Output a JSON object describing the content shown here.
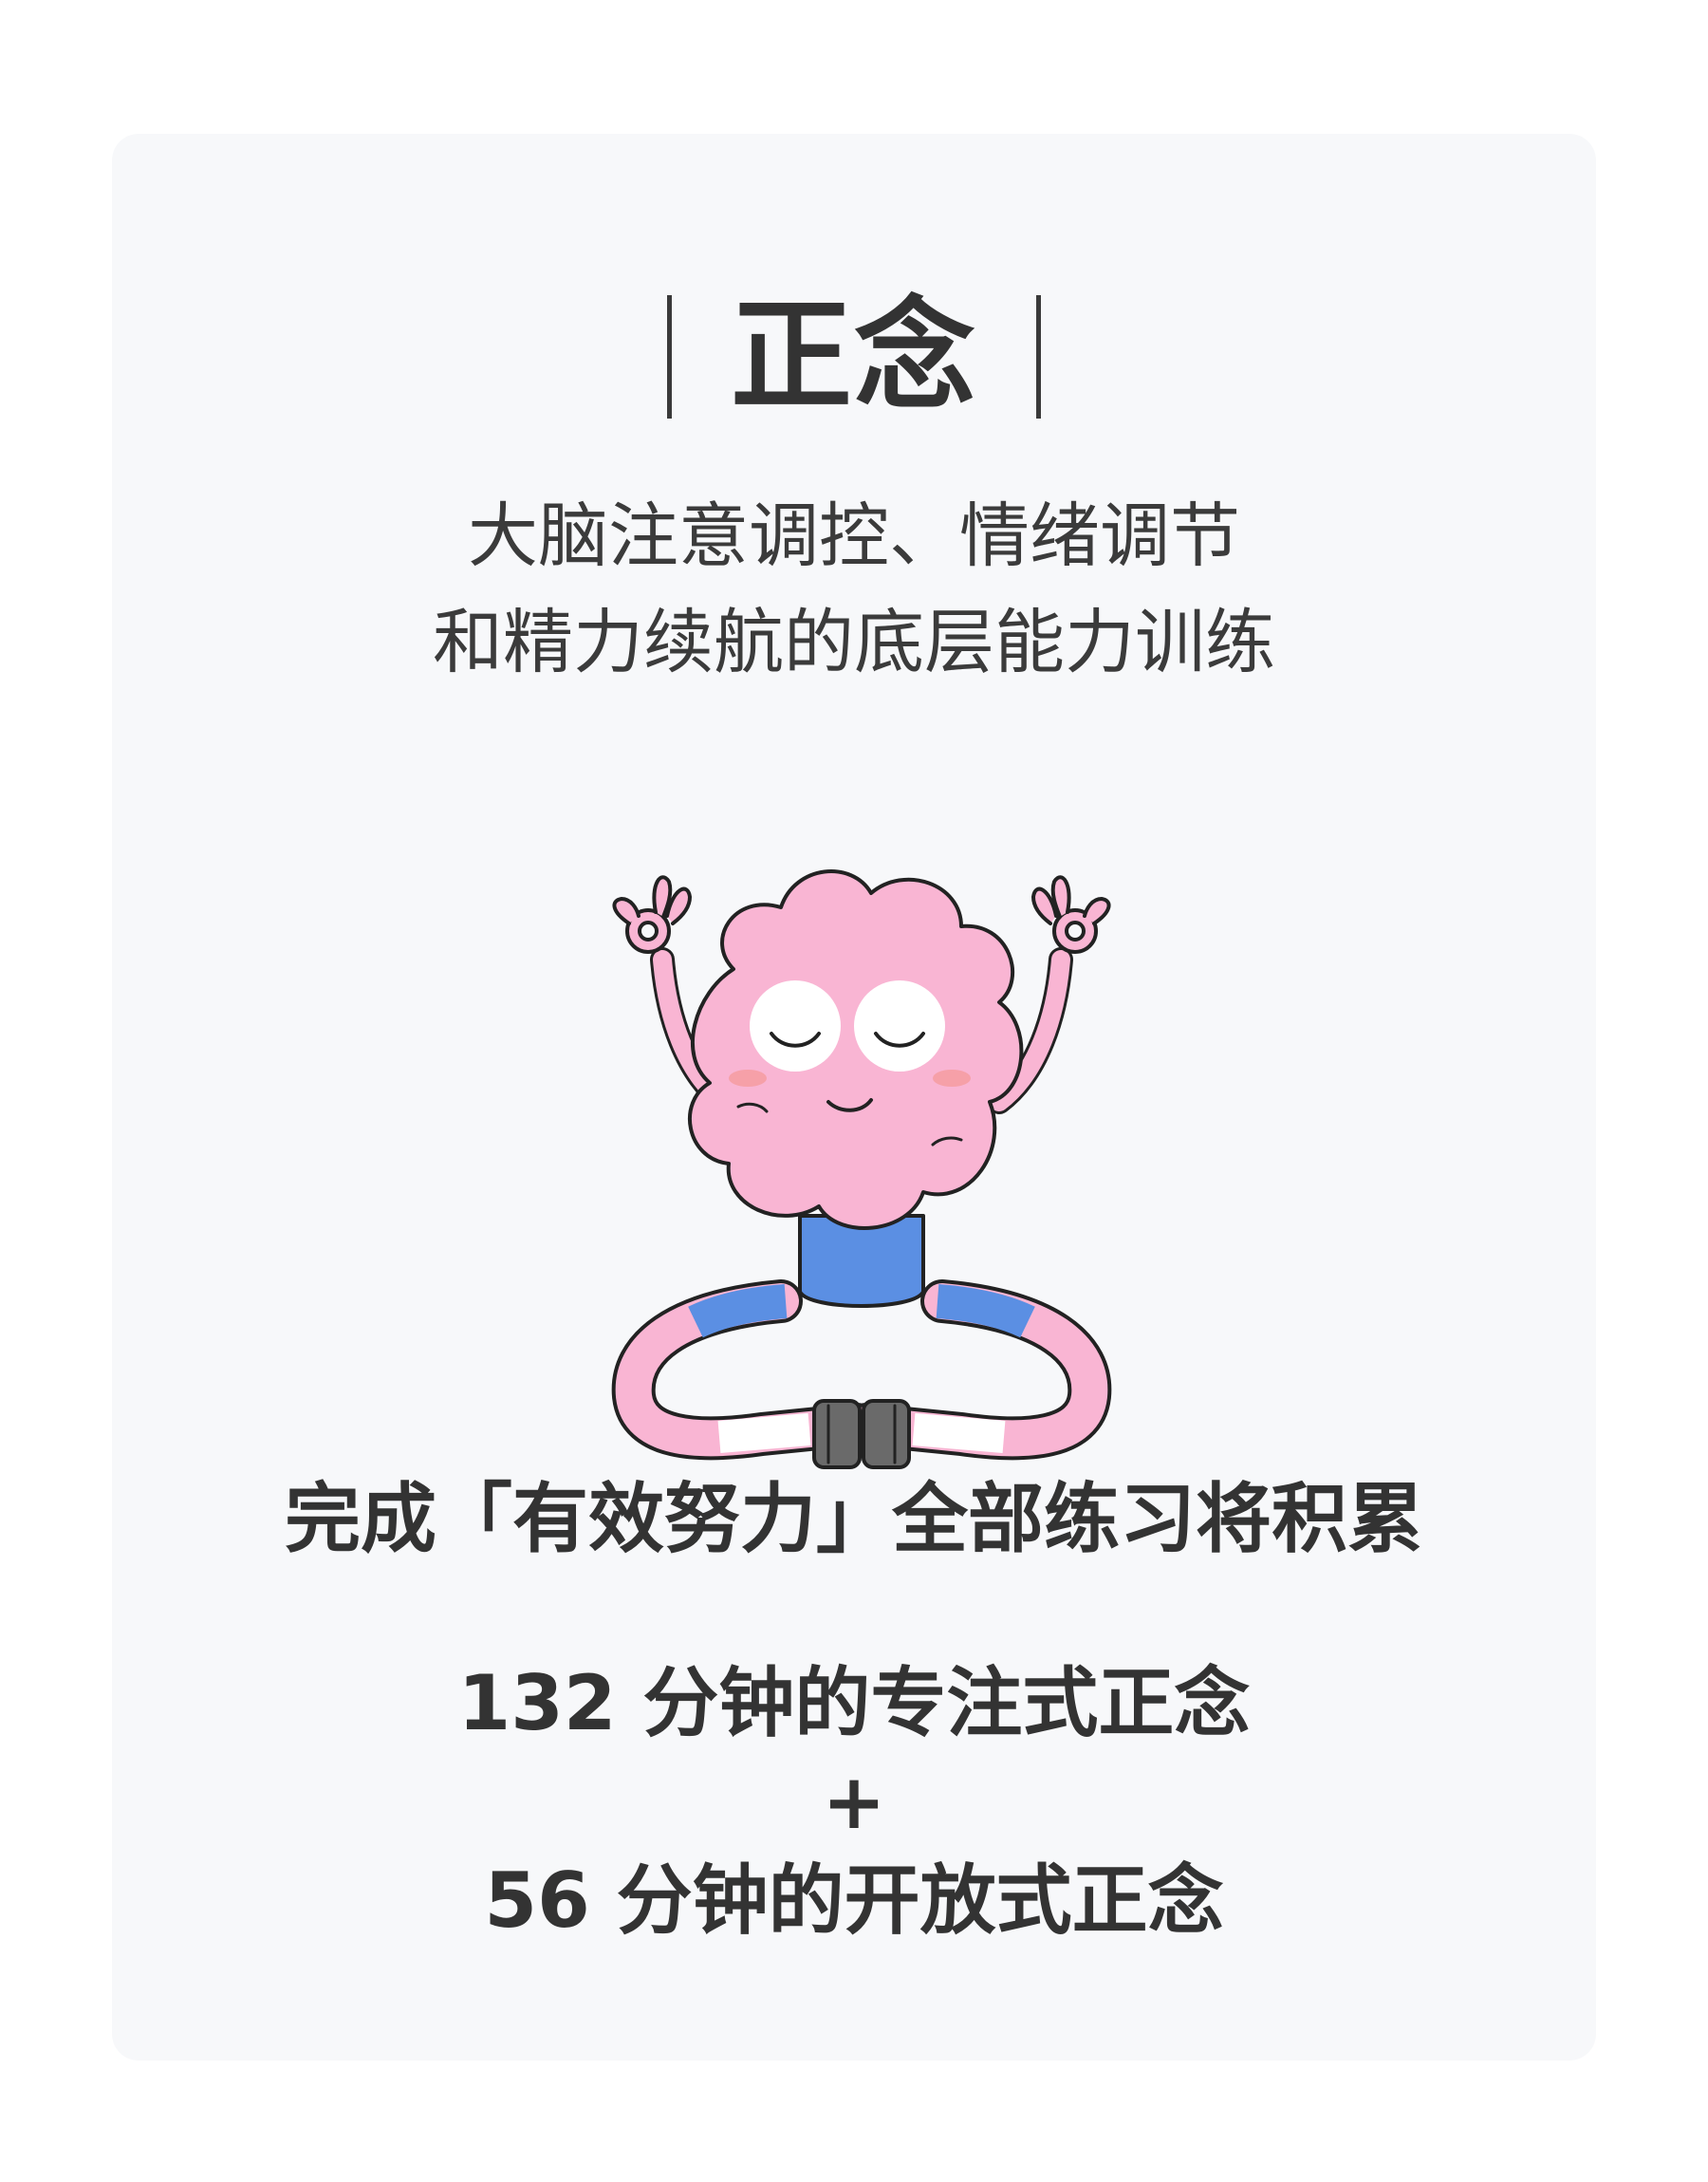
{
  "card": {
    "title": "正念",
    "subtitle_line1": "大脑注意调控、情绪调节",
    "subtitle_line2": "和精力续航的底层能力训练",
    "summary_heading": "完成「有效努力」全部练习将积累",
    "stat1": "132 分钟的专注式正念",
    "plus": "+",
    "stat2": "56 分钟的开放式正念"
  },
  "illustration": {
    "icon": "meditating-brain-icon",
    "brain_color": "#f9b5d3",
    "body_color": "#5b8fe3"
  }
}
